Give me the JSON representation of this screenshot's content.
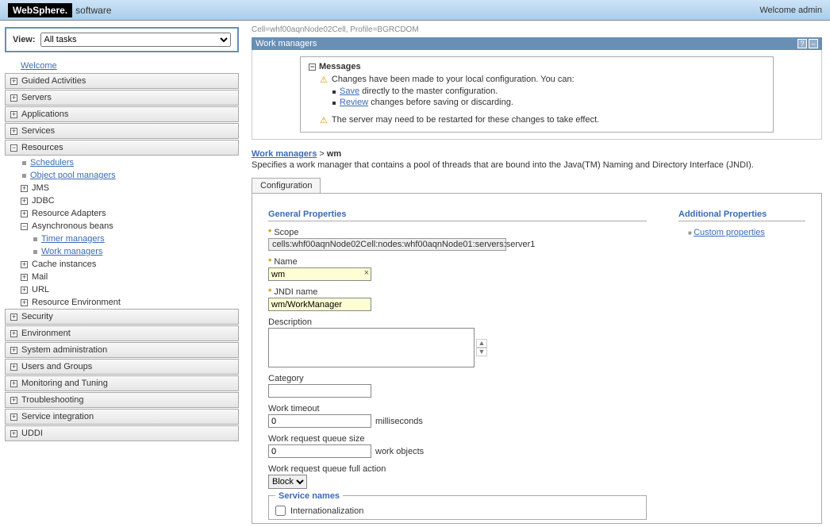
{
  "brand": {
    "logo": "WebSphere.",
    "sub": "software"
  },
  "welcome": "Welcome admin",
  "view": {
    "label": "View:",
    "selected": "All tasks"
  },
  "nav": {
    "welcome": "Welcome",
    "guided": "Guided Activities",
    "servers": "Servers",
    "applications": "Applications",
    "services": "Services",
    "resources": "Resources",
    "resourcesTree": {
      "schedulers": "Schedulers",
      "objectPool": "Object pool managers",
      "jms": "JMS",
      "jdbc": "JDBC",
      "resAdapters": "Resource Adapters",
      "asyncBeans": "Asynchronous beans",
      "timerMgr": "Timer managers",
      "workMgr": "Work managers",
      "cacheInst": "Cache instances",
      "mail": "Mail",
      "url": "URL",
      "resEnv": "Resource Environment"
    },
    "security": "Security",
    "environment": "Environment",
    "sysadmin": "System administration",
    "usersGroups": "Users and Groups",
    "monitoring": "Monitoring and Tuning",
    "troubleshooting": "Troubleshooting",
    "serviceInt": "Service integration",
    "uddi": "UDDI"
  },
  "context": "Cell=whf00aqnNode02Cell, Profile=BGRCDOM",
  "panelTitle": "Work managers",
  "messages": {
    "header": "Messages",
    "line1": "Changes have been made to your local configuration. You can:",
    "saveLink": "Save",
    "saveRest": " directly to the master configuration.",
    "reviewLink": "Review",
    "reviewRest": " changes before saving or discarding.",
    "restart": "The server may need to be restarted for these changes to take effect."
  },
  "breadcrumb": {
    "link": "Work managers",
    "sep": " > ",
    "current": "wm"
  },
  "pageDesc": "Specifies a work manager that contains a pool of threads that are bound into the Java(TM) Naming and Directory Interface (JNDI).",
  "tab": "Configuration",
  "form": {
    "genTitle": "General Properties",
    "scopeLabel": "Scope",
    "scopeValue": "cells:whf00aqnNode02Cell:nodes:whf00aqnNode01:servers:server1",
    "nameLabel": "Name",
    "nameValue": "wm",
    "jndiLabel": "JNDI name",
    "jndiValue": "wm/WorkManager",
    "descLabel": "Description",
    "descValue": "",
    "catLabel": "Category",
    "catValue": "",
    "wtLabel": "Work timeout",
    "wtValue": "0",
    "wtUnit": "milliseconds",
    "wrqLabel": "Work request queue size",
    "wrqValue": "0",
    "wrqUnit": "work objects",
    "wrfaLabel": "Work request queue full action",
    "wrfaValue": "Block",
    "svcTitle": "Service names",
    "svcIntl": "Internationalization"
  },
  "addProps": {
    "title": "Additional Properties",
    "custom": "Custom properties"
  }
}
